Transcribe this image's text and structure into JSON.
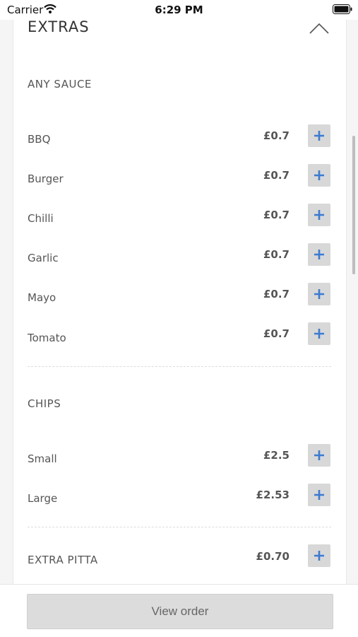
{
  "status_bar": {
    "carrier": "Carrier",
    "time": "6:29 PM"
  },
  "section": {
    "title": "EXTRAS"
  },
  "groups": [
    {
      "title": "ANY SAUCE",
      "items": [
        {
          "name": "BBQ",
          "price": "£0.7"
        },
        {
          "name": "Burger",
          "price": "£0.7"
        },
        {
          "name": "Chilli",
          "price": "£0.7"
        },
        {
          "name": "Garlic",
          "price": "£0.7"
        },
        {
          "name": "Mayo",
          "price": "£0.7"
        },
        {
          "name": "Tomato",
          "price": "£0.7"
        }
      ]
    },
    {
      "title": "CHIPS",
      "items": [
        {
          "name": "Small",
          "price": "£2.5"
        },
        {
          "name": "Large",
          "price": "£2.53"
        }
      ]
    }
  ],
  "extra_pitta": {
    "name": "EXTRA PITTA",
    "price": "£0.70"
  },
  "footer": {
    "view_order_label": "View order"
  },
  "colors": {
    "plus_icon": "#3a7bd5",
    "button_bg": "#d8d8d8"
  },
  "icons": {
    "collapse": "chevron-up-icon",
    "add": "plus-icon"
  }
}
